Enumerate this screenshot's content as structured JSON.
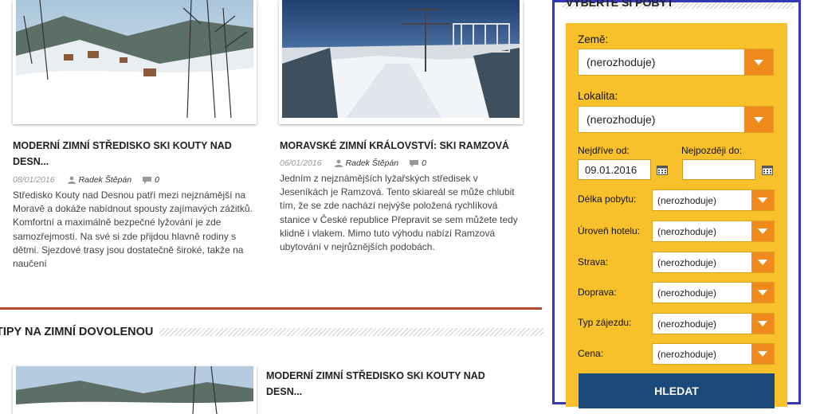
{
  "articles": [
    {
      "title": "MODERNÍ ZIMNÍ STŘEDISKO SKI KOUTY NAD DESN...",
      "date": "08/01/2016",
      "author": "Radek Štěpán",
      "comments": "0",
      "excerpt": "Středisko Kouty nad Desnou patří mezi nejznámější na Moravě a dokáže nabídnout spousty zajímavých zážitků. Komfortní a maximálně bezpečné lyžování je zde samozřejmostí. Na své si zde přijdou hlavně rodiny s dětmi. Sjezdové trasy jsou dostatečně široké, takže na naučení"
    },
    {
      "title": "MORAVSKÉ ZIMNÍ KRÁLOVSTVÍ: SKI RAMZOVÁ",
      "date": "06/01/2016",
      "author": "Radek Štěpán",
      "comments": "0",
      "excerpt": "Jedním z nejznámějších lyžařských středisek v Jeseníkách je Ramzová. Tento skiareál se může chlubit tím, že se zde nachází nejvýše položená rychlíková stanice v České republice Přepravit se sem můžete tedy klidně i vlakem. Mimo tuto výhodu nabízí Ramzová ubytování v nejrůznějších podobách."
    },
    {
      "title": "MODERNÍ ZIMNÍ STŘEDISKO SKI KOUTY NAD DESN..."
    }
  ],
  "section": {
    "title": "TIPY NA ZIMNÍ DOVOLENOU"
  },
  "sidebar": {
    "heading": "VYBERTE SI POBYT",
    "country_label": "Země:",
    "country_value": "(nerozhoduje)",
    "locality_label": "Lokalita:",
    "locality_value": "(nerozhoduje)",
    "from_label": "Nejdříve od:",
    "from_value": "09.01.2016",
    "to_label": "Nejpozději do:",
    "to_value": "",
    "filters": [
      {
        "label": "Délka pobytu:",
        "value": "(nerozhoduje)"
      },
      {
        "label": "Úroveň hotelu:",
        "value": "(nerozhoduje)"
      },
      {
        "label": "Strava:",
        "value": "(nerozhoduje)"
      },
      {
        "label": "Doprava:",
        "value": "(nerozhoduje)"
      },
      {
        "label": "Typ zájezdu:",
        "value": "(nerozhoduje)"
      },
      {
        "label": "Cena:",
        "value": "(nerozhoduje)"
      }
    ],
    "search_button": "HLEDAT"
  },
  "colors": {
    "panel": "#f8c12c",
    "arrow": "#f08a1c",
    "button": "#1b4a7a",
    "frame": "#3338b8",
    "rule": "#b7472a"
  },
  "icons": [
    "person-icon",
    "comment-icon",
    "calendar-icon",
    "chevron-down-icon"
  ]
}
